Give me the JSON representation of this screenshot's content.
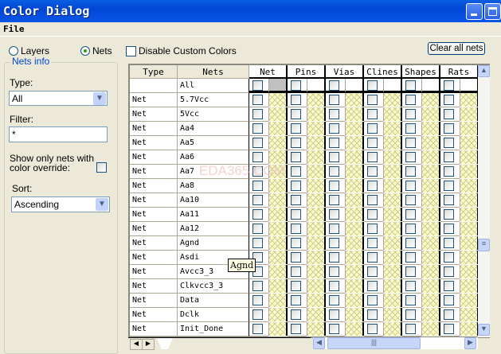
{
  "window": {
    "title": "Color Dialog"
  },
  "menu": {
    "file": "File"
  },
  "mode": {
    "layers": "Layers",
    "nets": "Nets",
    "selected": "Nets"
  },
  "disable_custom_colors": {
    "label": "Disable Custom Colors",
    "checked": false
  },
  "clear_all_nets": "Clear all nets",
  "nets_info": {
    "legend": "Nets info",
    "type_label": "Type:",
    "type_value": "All",
    "filter_label": "Filter:",
    "filter_value": "*",
    "show_only_label_1": "Show only nets with",
    "show_only_label_2": "color override:",
    "show_only_checked": false,
    "sort_label": "Sort:",
    "sort_value": "Ascending"
  },
  "grid": {
    "columns": [
      "Type",
      "Nets",
      "Net",
      "Pins",
      "Vias",
      "Clines",
      "Shapes",
      "Rats"
    ],
    "rows": [
      [
        "",
        "All"
      ],
      [
        "Net",
        "5.7Vcc"
      ],
      [
        "Net",
        "5Vcc"
      ],
      [
        "Net",
        "Aa4"
      ],
      [
        "Net",
        "Aa5"
      ],
      [
        "Net",
        "Aa6"
      ],
      [
        "Net",
        "Aa7"
      ],
      [
        "Net",
        "Aa8"
      ],
      [
        "Net",
        "Aa10"
      ],
      [
        "Net",
        "Aa11"
      ],
      [
        "Net",
        "Aa12"
      ],
      [
        "Net",
        "Agnd"
      ],
      [
        "Net",
        "Asdi"
      ],
      [
        "Net",
        "Avcc3_3"
      ],
      [
        "Net",
        "Clkvcc3_3"
      ],
      [
        "Net",
        "Data"
      ],
      [
        "Net",
        "Dclk"
      ],
      [
        "Net",
        "Init_Done"
      ]
    ]
  },
  "tooltip": "Agnd",
  "watermark": "EDA365.COM"
}
